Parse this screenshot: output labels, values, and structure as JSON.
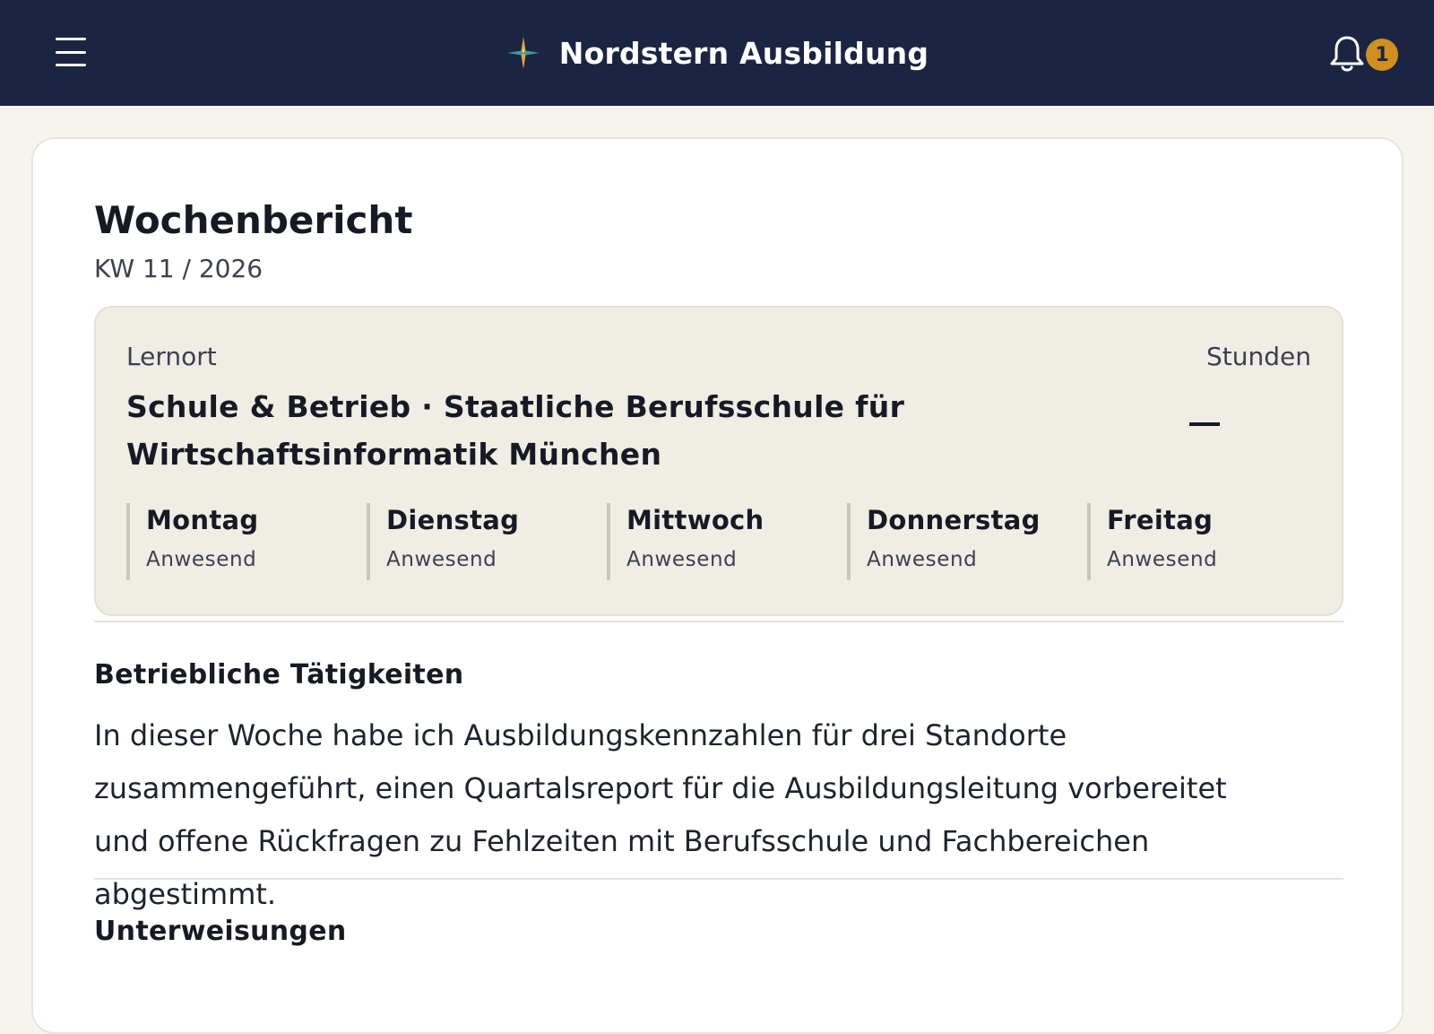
{
  "header": {
    "app_title": "Nordstern Ausbildung",
    "notification_count": "1",
    "icons": {
      "menu": "hamburger-menu-icon",
      "logo": "star-logo-icon",
      "notifications": "bell-icon"
    }
  },
  "report": {
    "title": "Wochenbericht",
    "week": "KW 11 / 2026",
    "lernort_label": "Lernort",
    "lernort_value": "Schule & Betrieb · Staatliche Berufsschule für Wirtschaftsinformatik München",
    "stunden_label": "Stunden",
    "stunden_value": "—",
    "days": [
      {
        "name": "Montag",
        "status": "Anwesend"
      },
      {
        "name": "Dienstag",
        "status": "Anwesend"
      },
      {
        "name": "Mittwoch",
        "status": "Anwesend"
      },
      {
        "name": "Donnerstag",
        "status": "Anwesend"
      },
      {
        "name": "Freitag",
        "status": "Anwesend"
      }
    ]
  },
  "sections": {
    "betrieb_title": "Betriebliche Tätigkeiten",
    "betrieb_text": "In dieser Woche habe ich Ausbildungskennzahlen für drei Standorte zusammengeführt, einen Quartalsreport für die Ausbildungsleitung vorbereitet und offene Rückfragen zu Fehlzeiten mit Berufsschule und Fachbereichen abgestimmt.",
    "unterweisungen_title": "Unterweisungen"
  },
  "colors": {
    "header_bg": "#1b2542",
    "badge": "#d18f1e",
    "page_bg": "#f5f4ee",
    "info_box_bg": "#f0ede5"
  }
}
